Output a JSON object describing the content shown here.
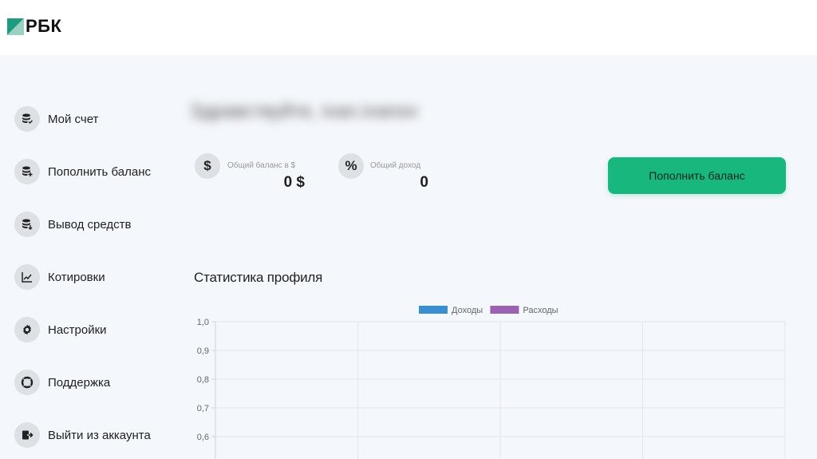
{
  "logo": {
    "text": "РБК"
  },
  "sidebar": {
    "items": [
      {
        "label": "Мой счет",
        "icon": "wallet-coins-icon"
      },
      {
        "label": "Пополнить баланс",
        "icon": "coins-add-icon"
      },
      {
        "label": "Вывод средств",
        "icon": "coins-withdraw-icon"
      },
      {
        "label": "Котировки",
        "icon": "chart-trend-icon"
      },
      {
        "label": "Настройки",
        "icon": "gear-icon"
      },
      {
        "label": "Поддержка",
        "icon": "lifebuoy-icon"
      },
      {
        "label": "Выйти из аккаунта",
        "icon": "logout-icon"
      }
    ]
  },
  "greeting": {
    "text": "Здравствуйте, ivan.ivanov"
  },
  "stats": {
    "balance": {
      "icon_glyph": "$",
      "title": "Общий баланс в $",
      "value": "0 $"
    },
    "income": {
      "icon_glyph": "%",
      "title": "Общий доход",
      "value": "0"
    }
  },
  "actions": {
    "topup_label": "Пополнить баланс"
  },
  "section": {
    "title": "Статистика профиля"
  },
  "colors": {
    "accent": "#18b77e",
    "income_series": "#3a8fd0",
    "expense_series": "#9a62b0"
  },
  "chart_data": {
    "type": "line",
    "title": "",
    "xlabel": "",
    "ylabel": "",
    "legend": "top-center",
    "grid": true,
    "series": [
      {
        "name": "Доходы",
        "color": "#3a8fd0",
        "values": []
      },
      {
        "name": "Расходы",
        "color": "#9a62b0",
        "values": []
      }
    ],
    "ylim": [
      0.5,
      1.0
    ],
    "y_ticks": [
      "1,0",
      "0,9",
      "0,8",
      "0,7",
      "0,6"
    ],
    "x_columns": 4
  }
}
